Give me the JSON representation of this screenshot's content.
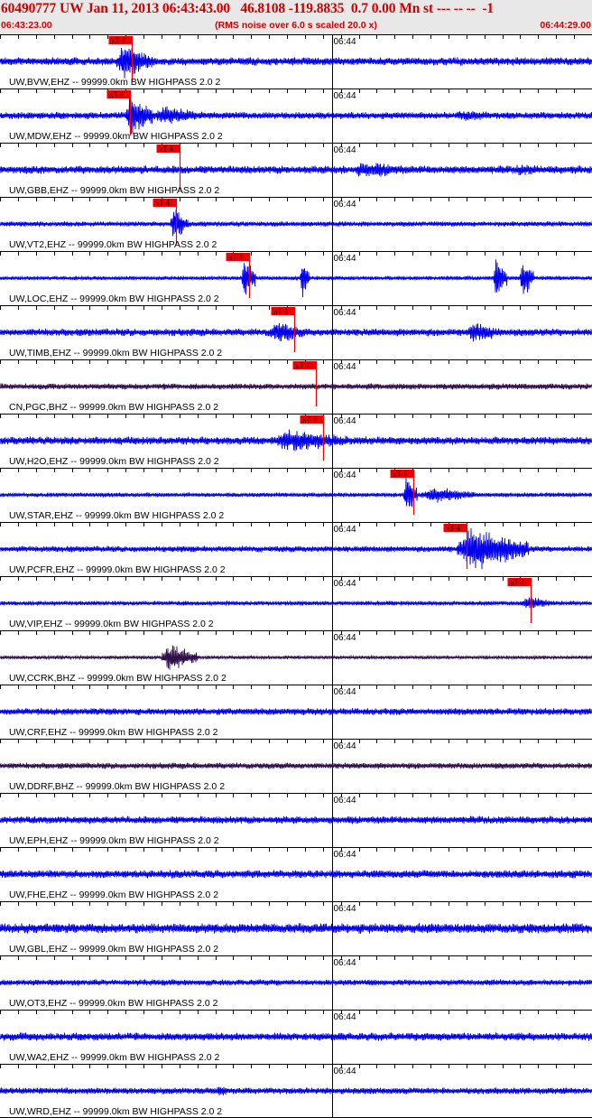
{
  "header": {
    "title": "60490777 UW Jan 11, 2013 06:43:43.00   46.8108 -119.8835  0.7 0.00 Mn st --- -- --  -1",
    "start_time": "06:43:23.00",
    "rms_note": "(RMS noise over 6.0 s scaled 20.0 x)",
    "end_time": "06:44:29.00"
  },
  "colors": {
    "header_text": "#cc0000",
    "header_bg": "#e8e8e8",
    "trace_blue": "#0000ee",
    "trace_dark": "#30104a",
    "pick_box": "#ee0000",
    "grid": "#000000"
  },
  "chart_data": {
    "type": "seismogram",
    "time_start": "06:43:23.00",
    "time_end": "06:44:29.00",
    "minute_mark_label": "06:44",
    "pick_label": "xT-4",
    "time_axis_seconds": [
      0,
      66
    ],
    "tick_interval_seconds": 2,
    "minute_mark_seconds": 37,
    "traces": [
      {
        "label": "UW,BVW,EHZ -- 99999.0km BW  HIGHPASS  2.0  2",
        "color": "blue",
        "noise": 0.16,
        "pick_seconds": 14.7,
        "bursts": [
          {
            "start": 13,
            "end": 17,
            "amp": 0.8
          }
        ]
      },
      {
        "label": "UW,MDW,EHZ -- 99999.0km BW  HIGHPASS  2.0  2",
        "color": "blue",
        "noise": 0.14,
        "pick_seconds": 14.5,
        "bursts": [
          {
            "start": 14,
            "end": 17,
            "amp": 0.95
          },
          {
            "start": 17,
            "end": 23,
            "amp": 0.45
          },
          {
            "start": 50,
            "end": 58,
            "amp": 0.25
          }
        ]
      },
      {
        "label": "UW,GBB,EHZ -- 99999.0km BW  HIGHPASS  2.0  2",
        "color": "blue",
        "noise": 0.16,
        "pick_seconds": 20.0,
        "bursts": [
          {
            "start": 39,
            "end": 47,
            "amp": 0.38
          },
          {
            "start": 57,
            "end": 62,
            "amp": 0.28
          }
        ]
      },
      {
        "label": "UW,VT2,EHZ -- 99999.0km BW  HIGHPASS  2.0  2",
        "color": "blue",
        "noise": 0.1,
        "pick_seconds": 19.6,
        "bursts": [
          {
            "start": 19,
            "end": 21,
            "amp": 0.75
          }
        ]
      },
      {
        "label": "UW,LOC,EHZ -- 99999.0km BW  HIGHPASS  2.0  2",
        "color": "blue",
        "noise": 0.08,
        "pick_seconds": 27.8,
        "bursts": [
          {
            "start": 27,
            "end": 28.5,
            "amp": 0.95
          },
          {
            "start": 33.5,
            "end": 34.5,
            "amp": 0.95
          },
          {
            "start": 55,
            "end": 56.5,
            "amp": 0.95
          },
          {
            "start": 58,
            "end": 59.5,
            "amp": 0.95
          }
        ]
      },
      {
        "label": "UW,TIMB,EHZ -- 99999.0km BW  HIGHPASS  2.0  2",
        "color": "blue",
        "noise": 0.15,
        "pick_seconds": 32.8,
        "bursts": [
          {
            "start": 30,
            "end": 34,
            "amp": 0.55
          },
          {
            "start": 52,
            "end": 56,
            "amp": 0.5
          }
        ]
      },
      {
        "label": "CN,PGC,BHZ -- 99999.0km BW  HIGHPASS  2.0  2",
        "color": "dark",
        "noise": 0.12,
        "pick_seconds": 35.2,
        "bursts": []
      },
      {
        "label": "UW,H2O,EHZ -- 99999.0km BW  HIGHPASS  2.0  2",
        "color": "blue",
        "noise": 0.16,
        "pick_seconds": 36.0,
        "bursts": [
          {
            "start": 30,
            "end": 41,
            "amp": 0.5
          }
        ]
      },
      {
        "label": "UW,STAR,EHZ -- 99999.0km BW  HIGHPASS  2.0  2",
        "color": "blue",
        "noise": 0.09,
        "pick_seconds": 46.1,
        "bursts": [
          {
            "start": 45,
            "end": 46.5,
            "amp": 0.9
          },
          {
            "start": 47,
            "end": 53,
            "amp": 0.4
          }
        ]
      },
      {
        "label": "UW,PCFR,EHZ -- 99999.0km BW  HIGHPASS  2.0  2",
        "color": "blue",
        "noise": 0.12,
        "pick_seconds": 52.0,
        "bursts": [
          {
            "start": 51,
            "end": 59,
            "amp": 1.0
          }
        ]
      },
      {
        "label": "UW,VIP,EHZ -- 99999.0km BW  HIGHPASS  2.0  2",
        "color": "blue",
        "noise": 0.09,
        "pick_seconds": 59.2,
        "bursts": [
          {
            "start": 58,
            "end": 62,
            "amp": 0.3
          }
        ]
      },
      {
        "label": "UW,CCRK,BHZ -- 99999.0km BW  HIGHPASS  2.0  2",
        "color": "dark",
        "noise": 0.07,
        "pick_seconds": null,
        "bursts": [
          {
            "start": 18,
            "end": 22,
            "amp": 0.65
          }
        ]
      },
      {
        "label": "UW,CRF,EHZ -- 99999.0km BW  HIGHPASS  2.0  2",
        "color": "blue",
        "noise": 0.14,
        "pick_seconds": null,
        "bursts": []
      },
      {
        "label": "UW,DDRF,BHZ -- 99999.0km BW  HIGHPASS  2.0  2",
        "color": "dark",
        "noise": 0.12,
        "pick_seconds": null,
        "bursts": []
      },
      {
        "label": "UW,EPH,EHZ -- 99999.0km BW  HIGHPASS  2.0  2",
        "color": "blue",
        "noise": 0.15,
        "pick_seconds": null,
        "bursts": []
      },
      {
        "label": "UW,FHE,EHZ -- 99999.0km BW  HIGHPASS  2.0  2",
        "color": "blue",
        "noise": 0.16,
        "pick_seconds": null,
        "bursts": []
      },
      {
        "label": "UW,GBL,EHZ -- 99999.0km BW  HIGHPASS  2.0  2",
        "color": "blue",
        "noise": 0.2,
        "pick_seconds": null,
        "bursts": []
      },
      {
        "label": "UW,OT3,EHZ -- 99999.0km BW  HIGHPASS  2.0  2",
        "color": "blue",
        "noise": 0.12,
        "pick_seconds": null,
        "bursts": []
      },
      {
        "label": "UW,WA2,EHZ -- 99999.0km BW  HIGHPASS  2.0  2",
        "color": "blue",
        "noise": 0.16,
        "pick_seconds": null,
        "bursts": []
      },
      {
        "label": "UW,WRD,EHZ -- 99999.0km BW  HIGHPASS  2.0  2",
        "color": "blue",
        "noise": 0.13,
        "pick_seconds": null,
        "bursts": [
          {
            "start": 24,
            "end": 26,
            "amp": 0.3
          }
        ]
      }
    ]
  }
}
